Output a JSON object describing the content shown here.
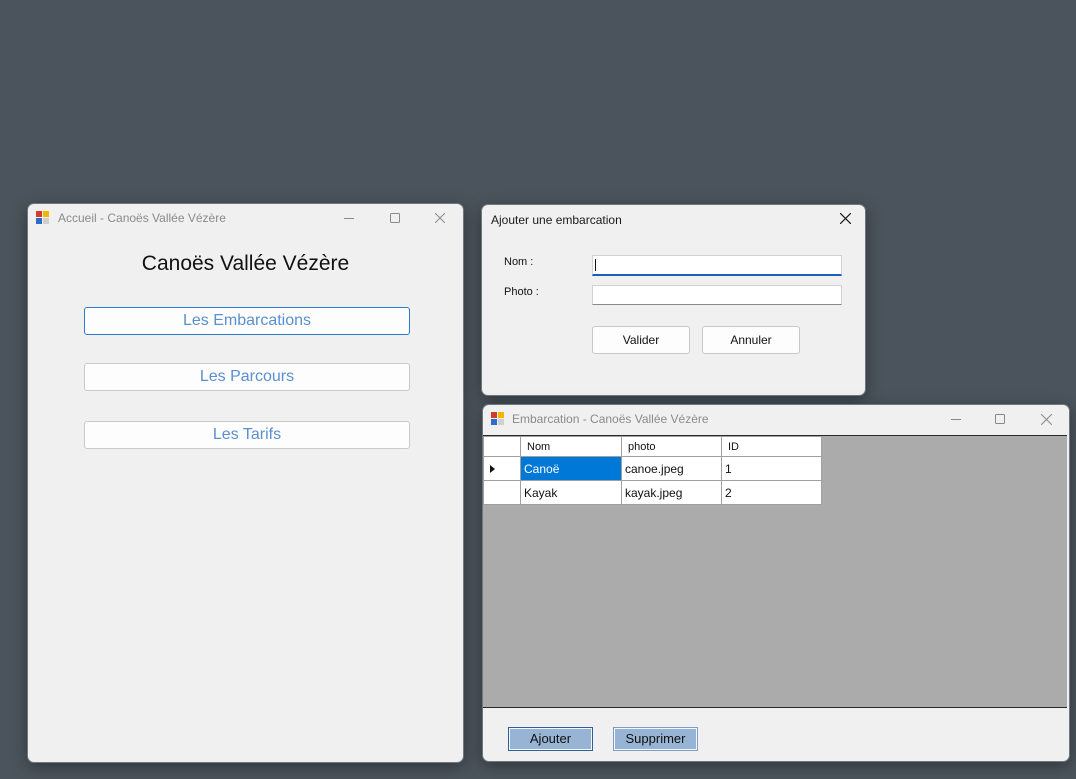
{
  "accueil": {
    "title": "Accueil - Canoës Vallée Vézère",
    "heading": "Canoës Vallée Vézère",
    "buttons": {
      "embarcations": "Les Embarcations",
      "parcours": "Les Parcours",
      "tarifs": "Les Tarifs"
    }
  },
  "ajouter": {
    "title": "Ajouter une embarcation",
    "nom_label": "Nom :",
    "photo_label": "Photo :",
    "nom_value": "",
    "photo_value": "",
    "valider": "Valider",
    "annuler": "Annuler"
  },
  "embarcation": {
    "title": "Embarcation - Canoës Vallée Vézère",
    "columns": [
      "Nom",
      "photo",
      "ID"
    ],
    "rows": [
      {
        "nom": "Canoë",
        "photo": "canoe.jpeg",
        "id": "1"
      },
      {
        "nom": "Kayak",
        "photo": "kayak.jpeg",
        "id": "2"
      }
    ],
    "ajouter": "Ajouter",
    "supprimer": "Supprimer"
  },
  "colors": {
    "desktop": "#4b545c",
    "window_bg": "#f0f0f0",
    "link_blue": "#5b8fcf",
    "selection": "#0078d7",
    "grid_bg": "#ababab",
    "button_blue": "#98b4d4"
  },
  "icons": [
    "app-icon",
    "minimize-icon",
    "maximize-icon",
    "close-icon",
    "row-indicator-icon"
  ]
}
